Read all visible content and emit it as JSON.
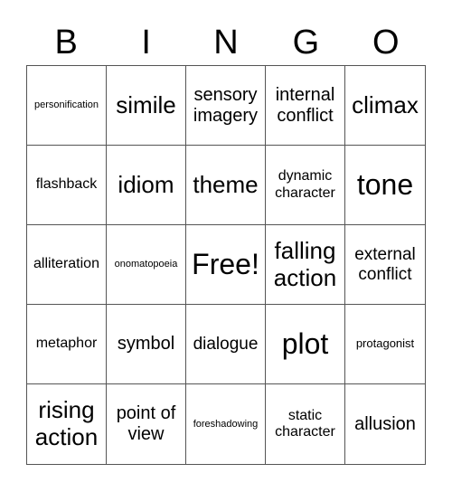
{
  "header": [
    "B",
    "I",
    "N",
    "G",
    "O"
  ],
  "cells": [
    {
      "text": "personification",
      "size": "s-xs"
    },
    {
      "text": "simile",
      "size": "s-xl"
    },
    {
      "text": "sensory imagery",
      "size": "s-lg"
    },
    {
      "text": "internal conflict",
      "size": "s-lg"
    },
    {
      "text": "climax",
      "size": "s-xl"
    },
    {
      "text": "flashback",
      "size": "s-md"
    },
    {
      "text": "idiom",
      "size": "s-xl"
    },
    {
      "text": "theme",
      "size": "s-xl"
    },
    {
      "text": "dynamic character",
      "size": "s-md"
    },
    {
      "text": "tone",
      "size": "s-xxl"
    },
    {
      "text": "alliteration",
      "size": "s-md"
    },
    {
      "text": "onomatopoeia",
      "size": "s-xs"
    },
    {
      "text": "Free!",
      "size": "s-xxl"
    },
    {
      "text": "falling action",
      "size": "s-xl"
    },
    {
      "text": "external conflict",
      "size": "s-md2"
    },
    {
      "text": "metaphor",
      "size": "s-md"
    },
    {
      "text": "symbol",
      "size": "s-lg"
    },
    {
      "text": "dialogue",
      "size": "s-md2"
    },
    {
      "text": "plot",
      "size": "s-xxl"
    },
    {
      "text": "protagonist",
      "size": "s-sm"
    },
    {
      "text": "rising action",
      "size": "s-xl"
    },
    {
      "text": "point of view",
      "size": "s-lg"
    },
    {
      "text": "foreshadowing",
      "size": "s-xs"
    },
    {
      "text": "static character",
      "size": "s-md"
    },
    {
      "text": "allusion",
      "size": "s-lg"
    }
  ]
}
